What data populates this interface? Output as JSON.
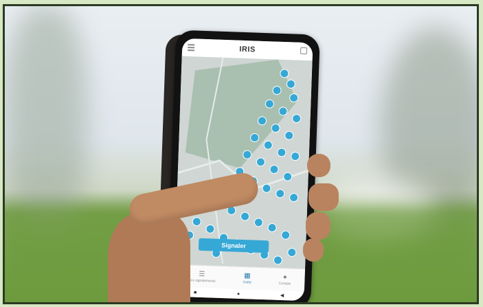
{
  "app": {
    "title": "IRIS",
    "report_button": "Signaler",
    "nav": [
      {
        "label": "Mes signalements",
        "icon": "list-icon"
      },
      {
        "label": "Carte",
        "icon": "map-icon"
      },
      {
        "label": "Compte",
        "icon": "user-icon"
      }
    ],
    "system_buttons": [
      "■",
      "●",
      "◀"
    ]
  },
  "colors": {
    "pin": "#36a8d6",
    "map_base": "#cfd6d3",
    "zone": "#b9ccc9",
    "accent": "#2d7fb3"
  }
}
